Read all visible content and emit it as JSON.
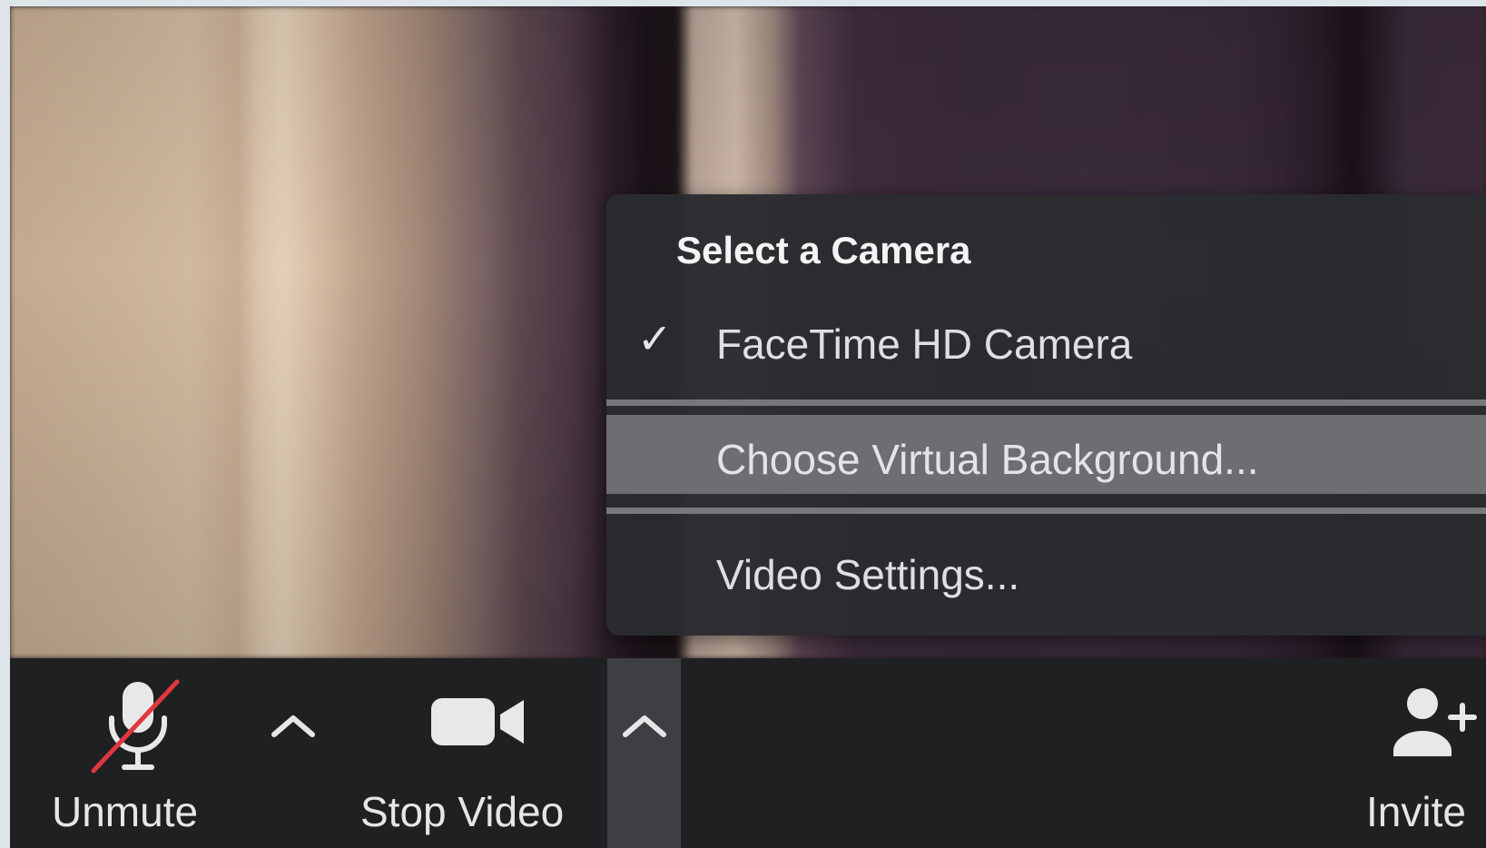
{
  "camera_menu": {
    "heading": "Select a Camera",
    "items": [
      {
        "label": "FaceTime HD Camera",
        "checked": true
      },
      {
        "label": "Choose Virtual Background...",
        "highlighted": true
      },
      {
        "label": "Video Settings..."
      }
    ],
    "check_glyph": "✓"
  },
  "toolbar": {
    "unmute_label": "Unmute",
    "stop_video_label": "Stop Video",
    "invite_label": "Invite"
  },
  "icons": {
    "mic": "microphone-muted-icon",
    "audio_chevron": "chevron-up-icon",
    "camera": "video-camera-icon",
    "video_chevron": "chevron-up-icon",
    "invite": "add-person-icon"
  },
  "colors": {
    "menu_bg": "#2a2b2f",
    "menu_highlight": "#6d6e72",
    "toolbar_bg": "#1f2022",
    "mute_slash": "#e0373f"
  }
}
